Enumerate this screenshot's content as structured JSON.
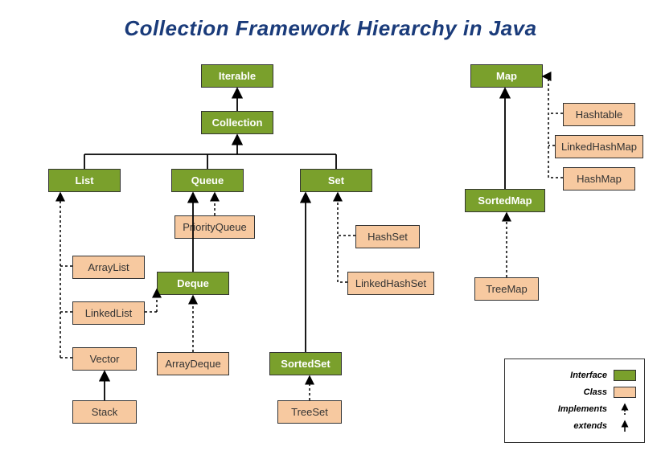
{
  "title": "Collection Framework Hierarchy in Java",
  "nodes": {
    "iterable": "Iterable",
    "collection": "Collection",
    "list": "List",
    "queue": "Queue",
    "set": "Set",
    "deque": "Deque",
    "sortedset": "SortedSet",
    "map": "Map",
    "sortedmap": "SortedMap",
    "arraylist": "ArrayList",
    "linkedlist": "LinkedList",
    "vector": "Vector",
    "stack": "Stack",
    "priorityqueue": "PriorityQueue",
    "arraydeque": "ArrayDeque",
    "treeset": "TreeSet",
    "hashset": "HashSet",
    "linkedhashset": "LinkedHashSet",
    "treemap": "TreeMap",
    "hashtable": "Hashtable",
    "linkedhashmap": "LinkedHashMap",
    "hashmap": "HashMap"
  },
  "legend": {
    "interface": "Interface",
    "class": "Class",
    "implements": "Implements",
    "extends": "extends"
  },
  "chart_data": {
    "type": "hierarchy-diagram",
    "node_types": {
      "interface": [
        "Iterable",
        "Collection",
        "List",
        "Queue",
        "Set",
        "Deque",
        "SortedSet",
        "Map",
        "SortedMap"
      ],
      "class": [
        "ArrayList",
        "LinkedList",
        "Vector",
        "Stack",
        "PriorityQueue",
        "ArrayDeque",
        "TreeSet",
        "HashSet",
        "LinkedHashSet",
        "TreeMap",
        "Hashtable",
        "LinkedHashMap",
        "HashMap"
      ]
    },
    "edges": [
      {
        "from": "Collection",
        "to": "Iterable",
        "rel": "extends"
      },
      {
        "from": "List",
        "to": "Collection",
        "rel": "extends"
      },
      {
        "from": "Queue",
        "to": "Collection",
        "rel": "extends"
      },
      {
        "from": "Set",
        "to": "Collection",
        "rel": "extends"
      },
      {
        "from": "Deque",
        "to": "Queue",
        "rel": "extends"
      },
      {
        "from": "SortedSet",
        "to": "Set",
        "rel": "extends"
      },
      {
        "from": "SortedMap",
        "to": "Map",
        "rel": "extends"
      },
      {
        "from": "ArrayList",
        "to": "List",
        "rel": "implements"
      },
      {
        "from": "LinkedList",
        "to": "List",
        "rel": "implements"
      },
      {
        "from": "LinkedList",
        "to": "Deque",
        "rel": "implements"
      },
      {
        "from": "Vector",
        "to": "List",
        "rel": "implements"
      },
      {
        "from": "Stack",
        "to": "Vector",
        "rel": "extends"
      },
      {
        "from": "PriorityQueue",
        "to": "Queue",
        "rel": "implements"
      },
      {
        "from": "ArrayDeque",
        "to": "Deque",
        "rel": "implements"
      },
      {
        "from": "HashSet",
        "to": "Set",
        "rel": "implements"
      },
      {
        "from": "LinkedHashSet",
        "to": "Set",
        "rel": "implements"
      },
      {
        "from": "TreeSet",
        "to": "SortedSet",
        "rel": "implements"
      },
      {
        "from": "TreeMap",
        "to": "SortedMap",
        "rel": "implements"
      },
      {
        "from": "Hashtable",
        "to": "Map",
        "rel": "implements"
      },
      {
        "from": "LinkedHashMap",
        "to": "Map",
        "rel": "implements"
      },
      {
        "from": "HashMap",
        "to": "Map",
        "rel": "implements"
      }
    ]
  }
}
